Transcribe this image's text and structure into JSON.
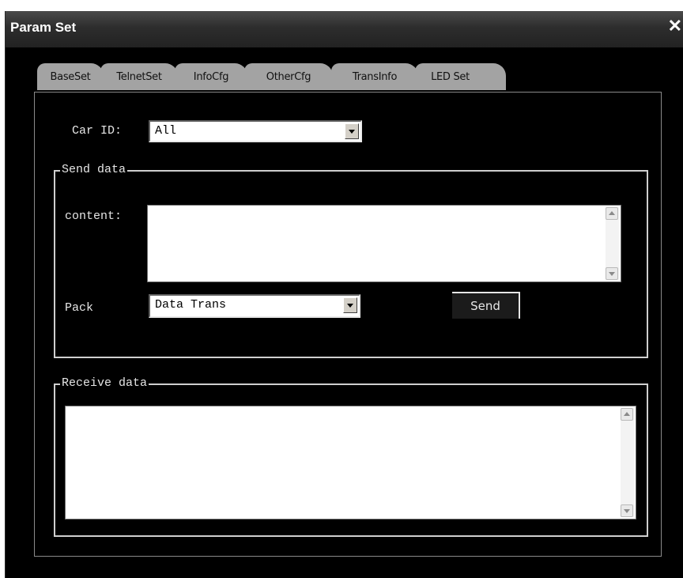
{
  "window": {
    "title": "Param Set",
    "close_icon": "close-icon"
  },
  "tabs": [
    {
      "label": "BaseSet"
    },
    {
      "label": "TelnetSet"
    },
    {
      "label": "InfoCfg"
    },
    {
      "label": "OtherCfg"
    },
    {
      "label": "TransInfo",
      "active": true
    },
    {
      "label": "LED Set"
    }
  ],
  "colors": {
    "active_tab": "#33dd3c",
    "tab": "#a3a3a3",
    "background": "#000000"
  },
  "car_id": {
    "label": "Car ID:",
    "value": "All"
  },
  "send_group": {
    "legend": "Send data",
    "content_label": "content:",
    "content_value": "",
    "pack_label": "Pack",
    "pack_value": "Data Trans",
    "send_label": "Send"
  },
  "receive_group": {
    "legend": "Receive data",
    "content_value": ""
  }
}
